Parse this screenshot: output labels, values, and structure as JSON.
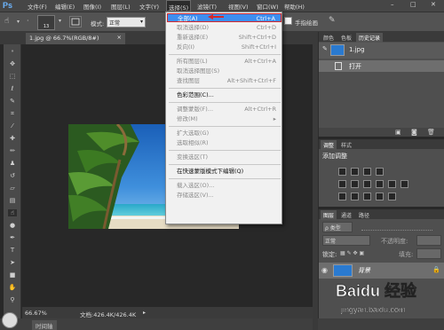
{
  "app": {
    "logo": "Ps"
  },
  "menubar": {
    "items": [
      "文件(F)",
      "编辑(E)",
      "图像(I)",
      "图层(L)",
      "文字(Y)",
      "选择(S)",
      "滤镜(T)",
      "视图(V)",
      "窗口(W)",
      "帮助(H)"
    ],
    "window_controls": [
      "–",
      "□",
      "✕"
    ]
  },
  "options": {
    "brush_size": "13",
    "mode_label": "模式:",
    "mode_value": "正常",
    "finger_label": "手指绘画"
  },
  "document": {
    "tab": "1.jpg @ 66.7%(RGB/8#)",
    "close": "×"
  },
  "select_menu": [
    {
      "label": "全部(A)",
      "shortcut": "Ctrl+A",
      "state": "highlight"
    },
    {
      "label": "取消选择(D)",
      "shortcut": "Ctrl+D",
      "state": "disabled"
    },
    {
      "label": "重新选择(E)",
      "shortcut": "Shift+Ctrl+D",
      "state": "disabled"
    },
    {
      "label": "反向(I)",
      "shortcut": "Shift+Ctrl+I",
      "state": "disabled"
    },
    {
      "sep": true
    },
    {
      "label": "所有图层(L)",
      "shortcut": "Alt+Ctrl+A",
      "state": "disabled"
    },
    {
      "label": "取消选择图层(S)",
      "shortcut": "",
      "state": "disabled"
    },
    {
      "label": "查找图层",
      "shortcut": "Alt+Shift+Ctrl+F",
      "state": "disabled"
    },
    {
      "sep": true
    },
    {
      "label": "色彩范围(C)...",
      "shortcut": "",
      "state": "normal"
    },
    {
      "sep": true
    },
    {
      "label": "调整蒙版(F)...",
      "shortcut": "Alt+Ctrl+R",
      "state": "disabled"
    },
    {
      "label": "修改(M)",
      "shortcut": "",
      "state": "disabled",
      "submenu": true
    },
    {
      "sep": true
    },
    {
      "label": "扩大选取(G)",
      "shortcut": "",
      "state": "disabled"
    },
    {
      "label": "选取相似(R)",
      "shortcut": "",
      "state": "disabled"
    },
    {
      "sep": true
    },
    {
      "label": "变换选区(T)",
      "shortcut": "",
      "state": "disabled"
    },
    {
      "sep": true
    },
    {
      "label": "在快速蒙版模式下编辑(Q)",
      "shortcut": "",
      "state": "normal"
    },
    {
      "sep": true
    },
    {
      "label": "载入选区(O)...",
      "shortcut": "",
      "state": "disabled"
    },
    {
      "label": "存储选区(V)...",
      "shortcut": "",
      "state": "disabled"
    }
  ],
  "history_panel": {
    "tabs": [
      "颜色",
      "色板",
      "历史记录"
    ],
    "snapshot": "1.jpg",
    "step": "打开"
  },
  "adjust_panel": {
    "tabs": [
      "调整",
      "样式"
    ],
    "title": "添加调整"
  },
  "layers_panel": {
    "tabs": [
      "图层",
      "通道",
      "路径"
    ],
    "filter": "ρ 类型",
    "blend": "正常",
    "opacity_label": "不透明度:",
    "lock_label": "锁定:",
    "fill_label": "填充:",
    "layer_name": "背景"
  },
  "status": {
    "zoom": "66.67%",
    "doc": "文档:426.4K/426.4K"
  },
  "bottom": {
    "tab": "时间轴"
  },
  "watermark": {
    "brand": "Baidu 经验",
    "url": "jingyan.baidu.com"
  },
  "colors": {
    "highlight": "#3d8ef0",
    "accent_red": "#d6282a"
  }
}
